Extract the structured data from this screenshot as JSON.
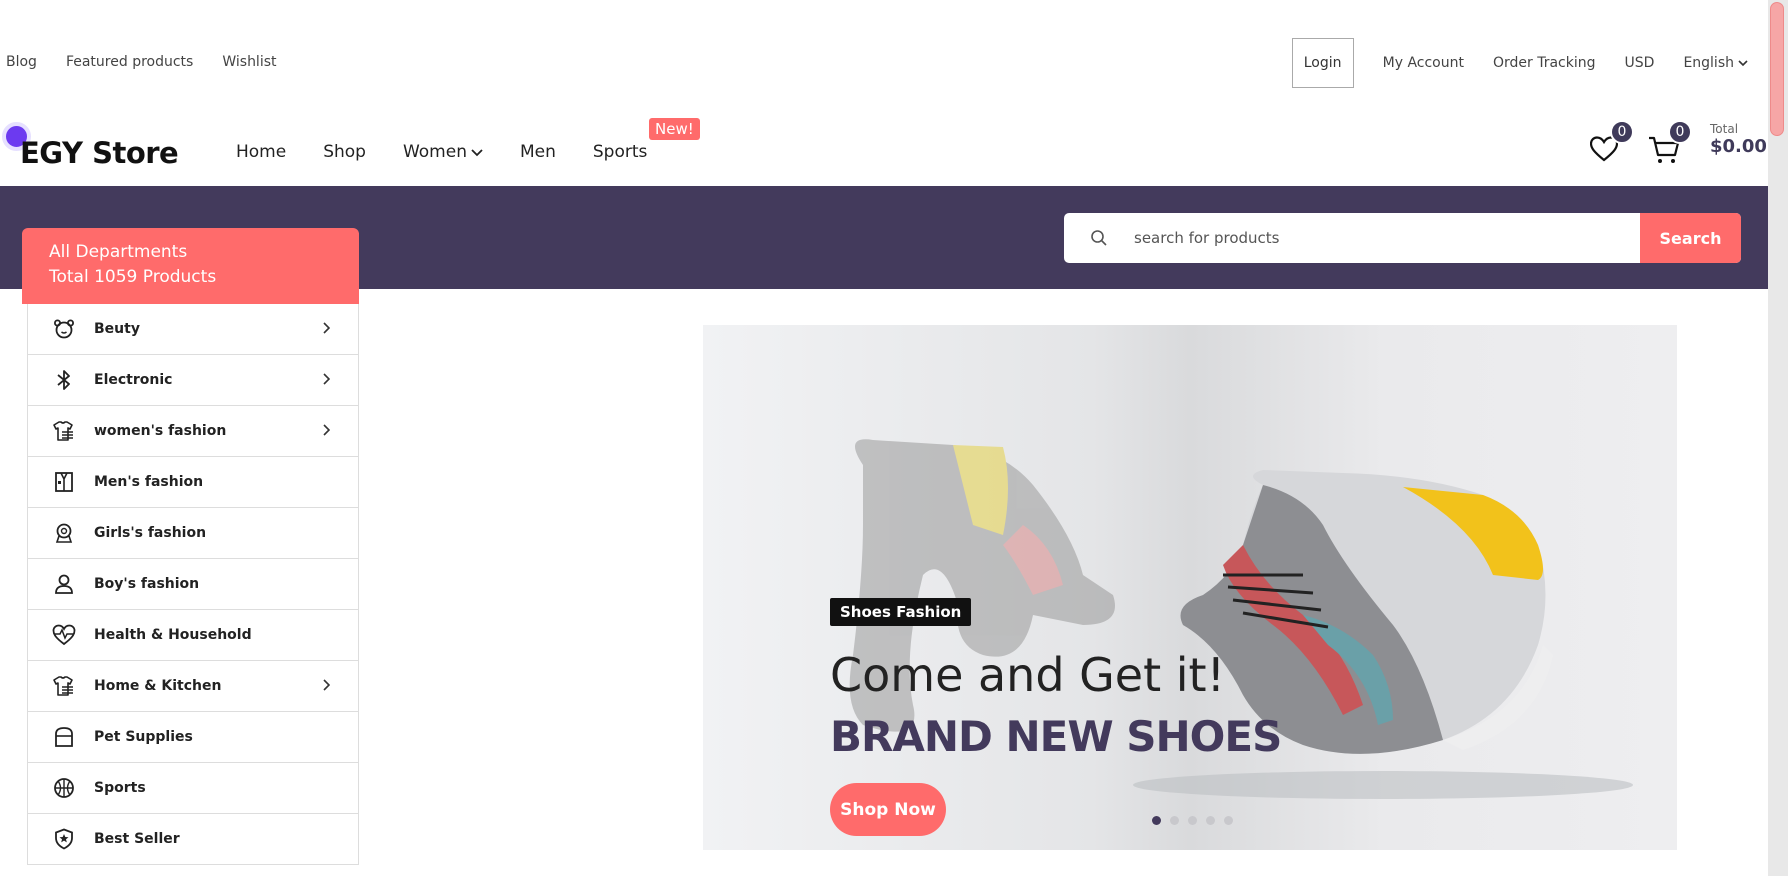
{
  "topbar": {
    "left_links": [
      "Blog",
      "Featured products",
      "Wishlist"
    ],
    "login_label": "Login",
    "right_links": [
      "My Account",
      "Order Tracking",
      "USD"
    ],
    "language": "English"
  },
  "header": {
    "logo": "EGY Store",
    "nav": [
      "Home",
      "Shop",
      "Women",
      "Men",
      "Sports"
    ],
    "new_badge": "New!",
    "wishlist_count": "0",
    "cart_count": "0",
    "total_label": "Total",
    "total_amount": "$0.00"
  },
  "search": {
    "placeholder": "search for products",
    "button_label": "Search"
  },
  "departments": {
    "title": "All Departments",
    "subtitle": "Total 1059 Products",
    "items": [
      {
        "label": "Beuty",
        "icon": "bear-icon",
        "has_sub": true
      },
      {
        "label": "Electronic",
        "icon": "bluetooth-icon",
        "has_sub": true
      },
      {
        "label": "women's fashion",
        "icon": "shirt-icon",
        "has_sub": true
      },
      {
        "label": "Men's fashion",
        "icon": "suit-icon",
        "has_sub": false
      },
      {
        "label": "Girls's fashion",
        "icon": "girl-icon",
        "has_sub": false
      },
      {
        "label": "Boy's fashion",
        "icon": "boy-icon",
        "has_sub": false
      },
      {
        "label": "Health & Household",
        "icon": "heartbeat-icon",
        "has_sub": false
      },
      {
        "label": "Home & Kitchen",
        "icon": "shirt-icon",
        "has_sub": true
      },
      {
        "label": "Pet Supplies",
        "icon": "pet-box-icon",
        "has_sub": false
      },
      {
        "label": "Sports",
        "icon": "basketball-icon",
        "has_sub": false
      },
      {
        "label": "Best Seller",
        "icon": "shield-star-icon",
        "has_sub": false
      }
    ]
  },
  "hero": {
    "tag": "Shoes Fashion",
    "line1": "Come and Get it!",
    "line2": "BRAND NEW SHOES",
    "button_label": "Shop Now",
    "slides": 5,
    "active_slide": 1
  },
  "colors": {
    "accent": "#ff6b6b",
    "brand_dark": "#433a5c",
    "logo_dot": "#6c3af0"
  }
}
